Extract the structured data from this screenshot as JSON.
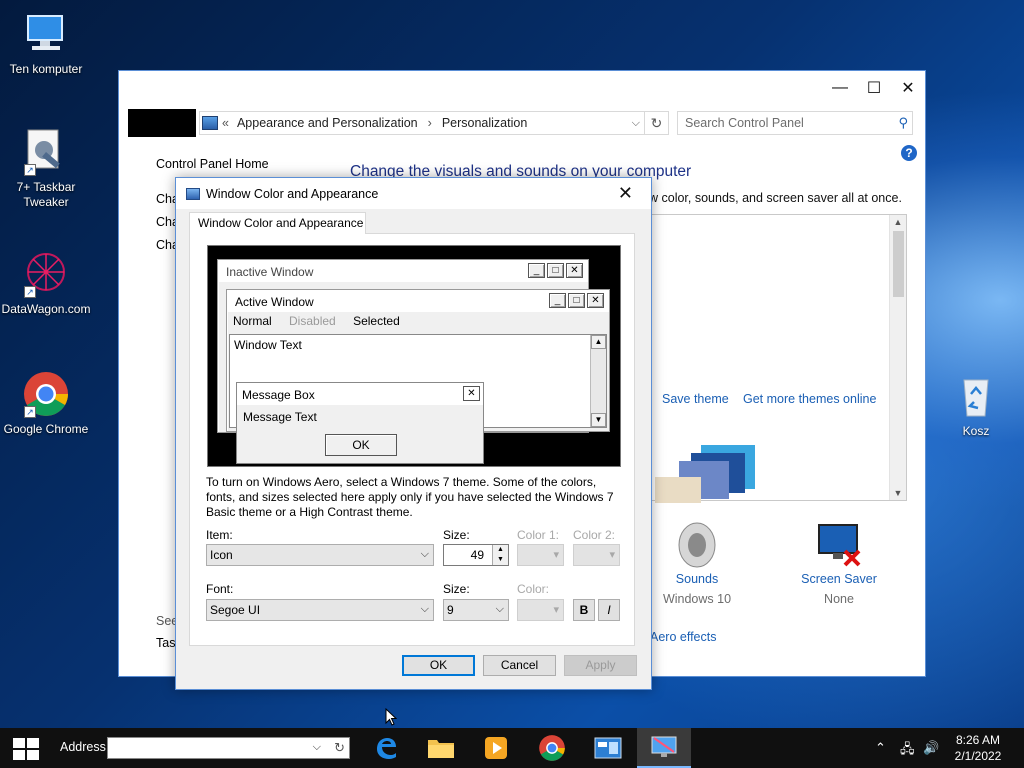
{
  "desktop": {
    "icons": [
      {
        "label": "Ten komputer",
        "icon": "computer-icon"
      },
      {
        "label": "7+ Taskbar Tweaker",
        "icon": "taskbar-tweaker-icon"
      },
      {
        "label": "DataWagon.com",
        "icon": "datawagon-icon"
      },
      {
        "label": "Google Chrome",
        "icon": "chrome-icon"
      },
      {
        "label": "Kosz",
        "icon": "recycle-bin-icon"
      }
    ]
  },
  "control_panel": {
    "breadcrumb": {
      "root_chevron": "«",
      "items": [
        "Appearance and Personalization",
        "Personalization"
      ],
      "separator": "›"
    },
    "search_placeholder": "Search Control Panel",
    "help": "?",
    "sidebar": {
      "home": "Control Panel Home",
      "links": [
        "Cha",
        "Cha",
        "Cha"
      ],
      "see_also": "See",
      "taskbar": "Task"
    },
    "heading": "Change the visuals and sounds on your computer",
    "subtext": "w color, sounds, and screen saver all at once.",
    "save_theme": "Save theme",
    "get_more_themes": "Get more themes online",
    "sounds": {
      "label": "Sounds",
      "value": "Windows 10"
    },
    "screen_saver": {
      "label": "Screen Saver",
      "value": "None"
    },
    "aero_effects": "Aero effects"
  },
  "dialog": {
    "title": "Window Color and Appearance",
    "tab": "Window Color and Appearance",
    "preview": {
      "inactive_title": "Inactive Window",
      "active_title": "Active Window",
      "menu": {
        "normal": "Normal",
        "disabled": "Disabled",
        "selected": "Selected"
      },
      "window_text": "Window Text",
      "msgbox_title": "Message Box",
      "msgbox_text": "Message Text",
      "msgbox_ok": "OK"
    },
    "info": "To turn on Windows Aero, select a Windows 7 theme.  Some of the colors, fonts, and sizes selected here apply only if you have selected the Windows 7 Basic theme or a High Contrast theme.",
    "item_label": "Item:",
    "item_value": "Icon",
    "size_label": "Size:",
    "size_value": "49",
    "color1_label": "Color 1:",
    "color2_label": "Color 2:",
    "font_label": "Font:",
    "font_value": "Segoe UI",
    "font_size_label": "Size:",
    "font_size_value": "9",
    "font_color_label": "Color:",
    "bold": "B",
    "italic": "I",
    "ok": "OK",
    "cancel": "Cancel",
    "apply": "Apply"
  },
  "taskbar": {
    "address_label": "Address",
    "address_value": "",
    "apps": [
      "edge-icon",
      "file-explorer-icon",
      "media-player-icon",
      "chrome-icon",
      "control-panel-icon",
      "personalization-icon"
    ],
    "time": "8:26 AM",
    "date": "2/1/2022"
  }
}
